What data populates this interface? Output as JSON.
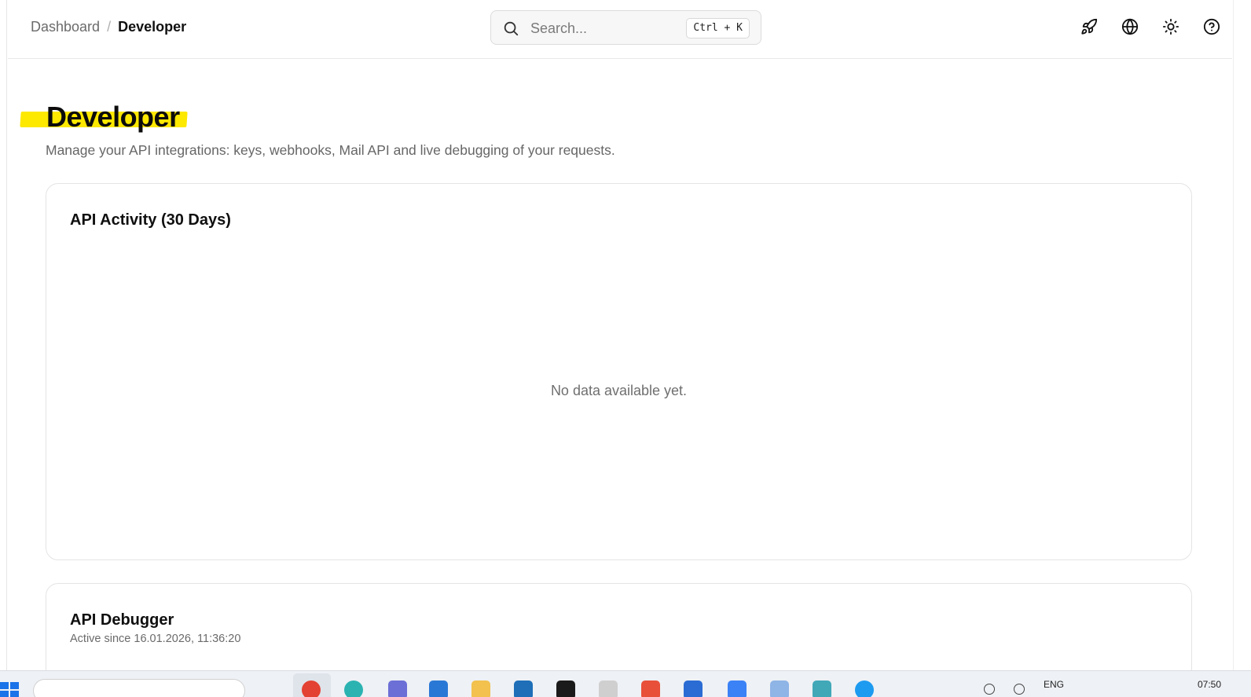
{
  "header": {
    "breadcrumb": {
      "root": "Dashboard",
      "separator": "/",
      "current": "Developer"
    },
    "search": {
      "placeholder": "Search...",
      "shortcut": "Ctrl + K"
    },
    "icons": [
      "rocket-icon",
      "globe-icon",
      "sun-icon",
      "help-icon"
    ]
  },
  "main": {
    "title": "Developer",
    "subtitle": "Manage your API integrations: keys, webhooks, Mail API and live debugging of your requests.",
    "highlight_color": "#fde800"
  },
  "activity_card": {
    "title": "API Activity (30 Days)",
    "empty_message": "No data available yet."
  },
  "debugger_card": {
    "title": "API Debugger",
    "status": "Active since 16.01.2026, 11:36:20"
  },
  "taskbar": {
    "language": "ENG",
    "time": "07:50"
  }
}
